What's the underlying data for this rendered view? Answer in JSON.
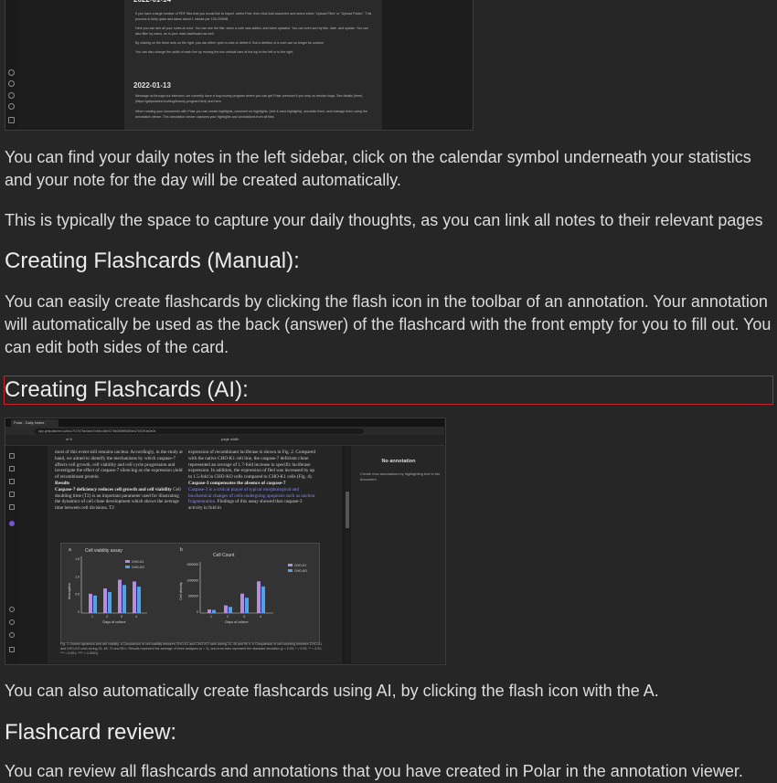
{
  "screenshot1": {
    "dates": [
      "2022-01-14",
      "2022-01-13"
    ],
    "day1_bullets": [
      "If you have a large number of PDF files that you would like to import, select Pole, then click Add document and select either \"Upload Files\" or \"Upload Folder\". This process is fairly quick and takes about 1 minute per 100-200MB.",
      "Here you can see all your notes at once. You can see the title, when a note was added, and when updated. You can even sort by title, date, and update. You can also filter by name, as in your main dashboard as well.",
      "By clicking on the three dots on the right, you can either open a note or delete it. But a deletion of a note can no longer be undone.",
      "You can also change the width of each line by moving the two vertical bars at the top to the left or to the right."
    ],
    "day2_bullets": [
      "Message us through our intercom, we currently have a bug bounty program where you can get Polar premium if you help us resolve bugs. See details (here)(https://getpolarized.io/blog/bounty-program.html) and here.",
      "When reading your documents with Polar you can create highlights, comment on highlights, (text & area highlights), annotate them, and manage them using the annotation viewer. This annotation viewer captures your highlights and annotations from all files."
    ]
  },
  "paragraphs": {
    "daily_notes": "You can find your daily notes in the left sidebar, click on the calendar symbol underneath your statistics and your note for the day will be created automatically.",
    "daily_thoughts": "This is typically the space to capture your daily thoughts, as you can link all notes to their relevant pages",
    "manual_body": "You can easily create flashcards by clicking the flash icon in the toolbar of an annotation. Your annotation will automatically be used as the back (answer) of the flashcard with the front empty for you to fill out. You can edit both sides of the card.",
    "ai_body": "You can also automatically create flashcards using AI, by clicking the flash icon with the A.",
    "review_body": "You can review all flashcards and annotations that you have created in Polar in the annotation viewer."
  },
  "headings": {
    "manual": "Creating Flashcards (Manual):",
    "ai": "Creating Flashcards (AI):",
    "review": "Flashcard review:"
  },
  "screenshot2": {
    "tab_title": "Polar - Daily Notes",
    "url": "app.getpolarized.io/doc/7f17b76e4aea7e4fbc48e0176b0698963b5e47b02f1fa0e0b",
    "page_indicator": "of 8",
    "zoom": "page width",
    "col_left": {
      "intro": "most of this event still remains unclear. Accordingly, in the study at hand, we aimed to identify the mechanisms by which caspase-7 affects cell growth, cell viability and cell cycle progression and investigate the effect of caspase-7 silencing on the expression yield of recombinant protein.",
      "results_heading": "Results",
      "results_sub": "Caspase-7 deficiency reduces cell growth and cell viability",
      "results_body": "Cell doubling time (T2) is an important parameter used for illustrating the dynamics of cell clone development which shows the average time between cell divisions. T2"
    },
    "col_right": {
      "intro": "expression of recombinant luciferase is shown in Fig. 2. Compared with the native CHO-K1 cell line, the caspase-7 deficient clone represented an average of 1.7-fold increase in specific luciferase expression. In addition, the expression of fled was increased by up to 1.5-fold in CHO-KO cells compared to CHO-K1 cells (Fig. 4).",
      "sub": "Caspase-3 compensates the absence of caspase-7",
      "highlight": "Caspase-3 is a critical player of typical morphological and biochemical changes of cells undergoing apoptosis such as nuclear fragmentation.",
      "after": "Findings of this assay showed that caspase-3 activity in fold in"
    },
    "figure": {
      "panel_a": "a",
      "panel_b": "b",
      "title_a": "Cell viability assay",
      "title_b": "Cell Count",
      "ylabel_a": "Absorption",
      "ylabel_b": "Cell density",
      "xlabel": "Days of culture",
      "legend": [
        "CHO-K1",
        "CHO-KO"
      ],
      "yticks_a": [
        "1.5",
        "1.0",
        "0.5",
        "0"
      ],
      "yticks_b": [
        "1500000",
        "1000000",
        "500000",
        "0"
      ],
      "xticks": [
        "1",
        "2",
        "3",
        "4"
      ],
      "colors": [
        "#b48ce6",
        "#4da3e6"
      ]
    },
    "caption": "Fig. 1 Growth dynamics and cell viability. a Comparison of cell viability between CHO-K1 and CHO-KO cells during 24, 48 and 96 h. b Comparison of cell counting between CHO-K1 and CHO-KO cells during 24, 48, 72 and 96 h. Results represent the average of three analyses (n = 3), and error bars represent the standard deviation (p < 0.05; * < 0.05; ** < 0.01; *** < 0.001; **** < 0.0001).",
    "sidebar_title": "No annotation",
    "sidebar_hint": "Create new annotations by highlighting text in the document"
  }
}
